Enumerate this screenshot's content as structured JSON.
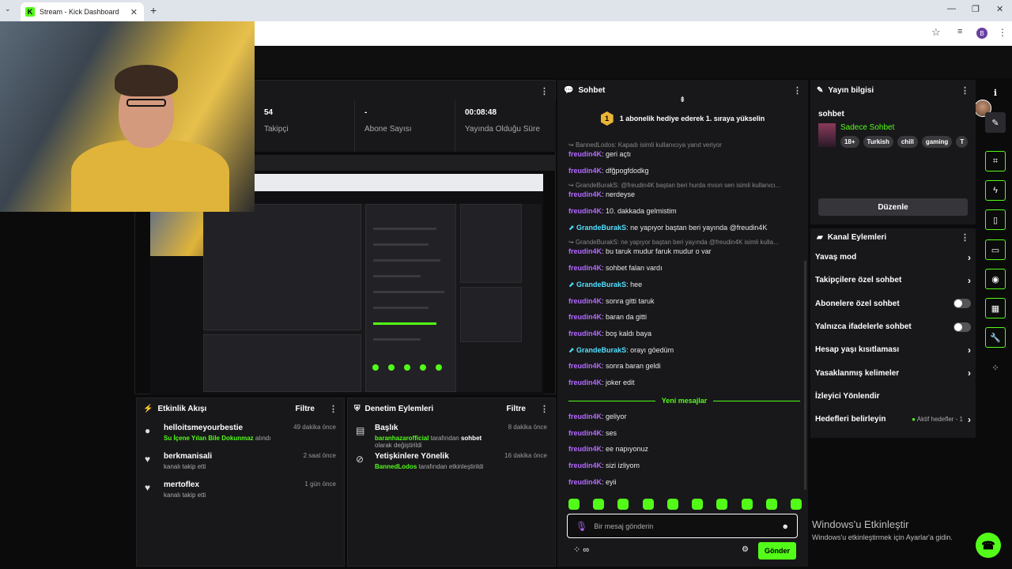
{
  "browser": {
    "tab_title": "Stream - Kick Dashboard",
    "favicon_letter": "K",
    "profile_letter": "B"
  },
  "stats": [
    {
      "value": "54",
      "label": "Takipçi"
    },
    {
      "value": "-",
      "label": "Abone Sayısı"
    },
    {
      "value": "00:08:48",
      "label": "Yayında Olduğu Süre"
    }
  ],
  "activity_feed": {
    "title": "Etkinlik Akışı",
    "filter_label": "Filtre",
    "items": [
      {
        "name": "helloitsmeyourbestie",
        "sub_highlight": "Su İçene Yılan Bile Dokunmaz",
        "sub": " alındı",
        "time": "49 dakika önce"
      },
      {
        "name": "berkmanisali",
        "sub_highlight": "",
        "sub": "kanalı takip etti",
        "time": "2 saat önce"
      },
      {
        "name": "mertoflex",
        "sub_highlight": "",
        "sub": "kanalı takip etti",
        "time": "1 gün önce"
      }
    ]
  },
  "mod_actions": {
    "title": "Denetim Eylemleri",
    "filter_label": "Filtre",
    "items": [
      {
        "name": "Başlık",
        "actor": "baranhazarofficial",
        "mid": " tarafından ",
        "target": "sohbet",
        "rest": " olarak değiştirildi",
        "time": "8 dakika önce"
      },
      {
        "name": "Yetişkinlere Yönelik",
        "actor": "BannedLodos",
        "mid": " tarafından etkinleştirildi",
        "target": "",
        "rest": "",
        "time": "16 dakika önce"
      }
    ]
  },
  "chat": {
    "title": "Sohbet",
    "pinned_badge": "1",
    "pinned_text": "1 abonelik hediye ederek 1. sıraya yükselin",
    "messages": [
      {
        "reply": "BannedLodos: Kapadı isimli kullanıcıya yanıt veriyor"
      },
      {
        "user": "freudin4K",
        "text": ": geri açtı"
      },
      {
        "user": "freudin4K",
        "text": ": dfğpogfdodkg"
      },
      {
        "reply": "GrandeBurakS: @freudin4K baştan beri hurda mısın sen isimli kullanıcı..."
      },
      {
        "user": "freudin4K",
        "text": ": nerdeyse"
      },
      {
        "user": "freudin4K",
        "text": ": 10. dakkada gelmistim"
      },
      {
        "user2": "GrandeBurakS",
        "text": ": ne yapıyor baştan beri yayında @freudin4K"
      },
      {
        "reply": "GrandeBurakS: ne yapıyor baştan beri yayında @freudin4K isimli kulla..."
      },
      {
        "user": "freudin4K",
        "text": ": bu taruk mudur faruk mudur o var"
      },
      {
        "user": "freudin4K",
        "text": ": sohbet falan vardı"
      },
      {
        "user2": "GrandeBurakS",
        "text": ": hee"
      },
      {
        "user": "freudin4K",
        "text": ": sonra gitti taruk"
      },
      {
        "user": "freudin4K",
        "text": ": baran da gitti"
      },
      {
        "user": "freudin4K",
        "text": ": boş kaldı baya"
      },
      {
        "user2": "GrandeBurakS",
        "text": ": orayı göedüm"
      },
      {
        "user": "freudin4K",
        "text": ": sonra baran geldi"
      },
      {
        "user": "freudin4K",
        "text": ": joker edit"
      }
    ],
    "new_messages_label": "Yeni mesajlar",
    "new_messages": [
      {
        "user": "freudin4K",
        "text": ": geliyor"
      },
      {
        "user": "freudin4K",
        "text": ": ses"
      },
      {
        "user": "freudin4K",
        "text": ": ee napıyonuz"
      },
      {
        "user": "freudin4K",
        "text": ": sizi izliyom"
      },
      {
        "user": "freudin4K",
        "text": ": eyii"
      }
    ],
    "input_placeholder": "Bir mesaj gönderin",
    "send_label": "Gönder"
  },
  "stream_info": {
    "title": "Yayın bilgisi",
    "stream_title": "sohbet",
    "category": "Sadece Sohbet",
    "tags": [
      "18+",
      "Turkish",
      "chill",
      "gaming",
      "T"
    ],
    "edit_label": "Düzenle"
  },
  "channel_actions": {
    "title": "Kanal Eylemleri",
    "items": [
      {
        "label": "Yavaş mod",
        "kind": "arrow"
      },
      {
        "label": "Takipçilere özel sohbet",
        "kind": "arrow"
      },
      {
        "label": "Abonelere özel sohbet",
        "kind": "toggle"
      },
      {
        "label": "Yalnızca ifadelerle sohbet",
        "kind": "toggle"
      },
      {
        "label": "Hesap yaşı kısıtlaması",
        "kind": "arrow"
      },
      {
        "label": "Yasaklanmış kelimeler",
        "kind": "arrow"
      },
      {
        "label": "İzleyici Yönlendir",
        "kind": "none"
      },
      {
        "label": "Hedefleri belirleyin",
        "kind": "arrow",
        "extra": "Aktif hedefler - 1"
      }
    ]
  },
  "watermark": {
    "line1": "Windows'u Etkinleştir",
    "line2": "Windows'u etkinleştirmek için Ayarlar'a gidin."
  },
  "colors": {
    "accent": "#53fc18",
    "panel": "#18181b",
    "username": "#b469ff",
    "username_alt": "#53e0ff"
  }
}
